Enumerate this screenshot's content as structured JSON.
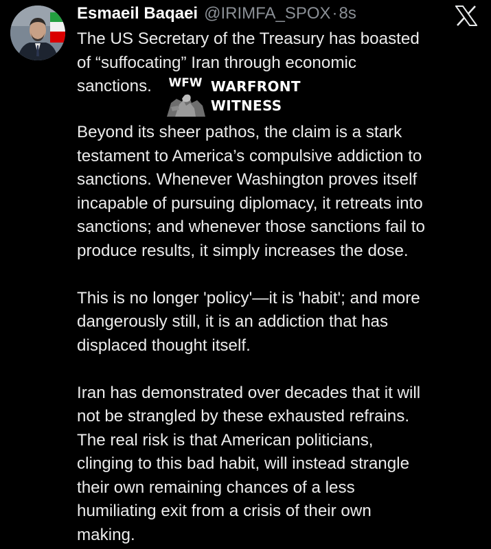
{
  "tweet": {
    "display_name": "Esmaeil Baqaei",
    "handle": "@IRIMFA_SPOX",
    "separator": "·",
    "time": "8s",
    "platform_icon": "x-logo-icon",
    "avatar_icon": "profile-avatar",
    "lines_intro": [
      "The US Secretary of the Treasury has boasted",
      "of “suffocating” Iran through economic"
    ],
    "line_sanctions": "sanctions.",
    "paragraph_1": [
      "Beyond its sheer pathos, the claim is a stark",
      "testament to America’s compulsive addiction to",
      "sanctions. Whenever Washington proves itself",
      "incapable of pursuing diplomacy, it retreats into",
      "sanctions; and whenever those sanctions fail to",
      "produce results, it simply increases the dose."
    ],
    "paragraph_2": [
      "This is no longer 'policy'—it is 'habit'; and more",
      "dangerously still, it is an addiction that has",
      "displaced thought itself."
    ],
    "paragraph_3": [
      "Iran has demonstrated over decades that it will",
      "not be strangled by these exhausted refrains.",
      "The real risk is that American politicians,",
      "clinging to this bad habit, will instead strangle",
      "their own remaining chances of a less",
      "humiliating exit from a crisis of their own",
      "making."
    ]
  },
  "watermark": {
    "logo_text": "WFW",
    "line1": "WARFRONT",
    "line2": "WITNESS"
  },
  "colors": {
    "background": "#000000",
    "text": "#ececec",
    "name": "#ffffff",
    "muted": "#8b9096"
  }
}
